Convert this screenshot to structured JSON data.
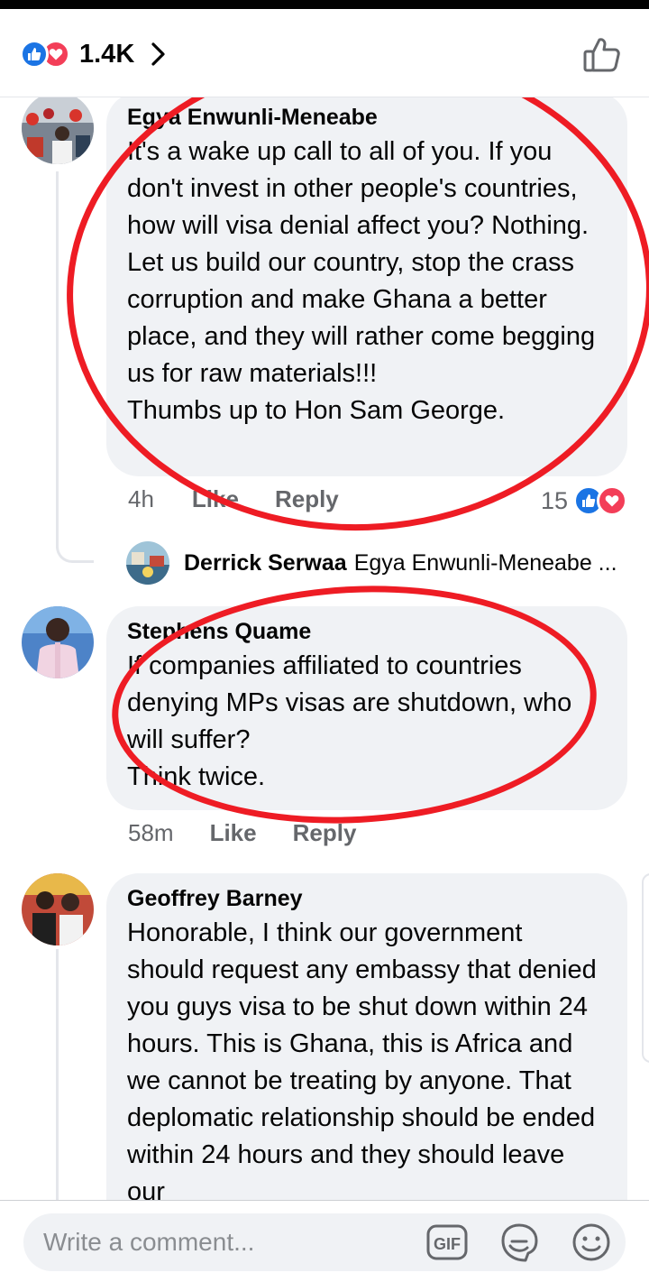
{
  "header": {
    "reaction_count": "1.4K",
    "reaction_icons": [
      "like-icon",
      "love-icon"
    ]
  },
  "comments": [
    {
      "author": "Egya Enwunli-Meneabe",
      "text": "It's a wake up call to all of you. If you don't invest in other people's countries, how will visa denial affect you? Nothing.\nLet us build our country, stop the crass corruption and make Ghana a better place, and they will rather come begging us for raw materials!!!\nThumbs up to Hon Sam George.",
      "time": "4h",
      "like_label": "Like",
      "reply_label": "Reply",
      "reaction_count": "15",
      "reply_preview": {
        "author": "Derrick Serwaa",
        "text": "Egya Enwunli-Meneabe ..."
      }
    },
    {
      "author": "Stephens Quame",
      "text": "If companies affiliated to countries denying MPs visas are shutdown, who will suffer?\nThink twice.",
      "time": "58m",
      "like_label": "Like",
      "reply_label": "Reply"
    },
    {
      "author": "Geoffrey Barney",
      "text": "Honorable, I think our government should request any embassy that denied you guys visa to be shut down within 24 hours. This is Ghana, this is Africa and we cannot be treating by anyone. That deplomatic relationship should be ended within 24 hours and they should leave our"
    }
  ],
  "composer": {
    "placeholder": "Write a comment...",
    "gif_label": "GIF",
    "icons": [
      "gif-icon",
      "sticker-icon",
      "emoji-icon"
    ]
  },
  "colors": {
    "like_blue": "#1b74e4",
    "love_red": "#f33e58",
    "annotation_red": "#ee1c24",
    "bubble_gray": "#f0f2f5",
    "meta_gray": "#65676b"
  }
}
